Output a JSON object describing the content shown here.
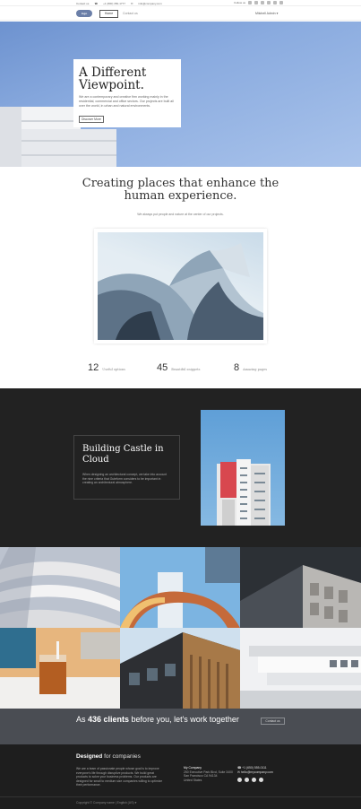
{
  "topbar": {
    "items": [
      "Contact us",
      "+1 (800) 350-1777",
      "info@company.com"
    ],
    "follow_label": "Follow us"
  },
  "nav": {
    "logo": "logo",
    "home": "Home",
    "contact": "Contact us",
    "user": "Mitchell Admin"
  },
  "hero": {
    "title": "A Different Viewpoint.",
    "text": "We are a contemporary and creative firm working mainly in the residential, commercial and office sectors. Our projects are built all over the world, in urban and natural environments.",
    "button": "Discover More"
  },
  "section_places": {
    "title": "Creating places that enhance the human experience.",
    "subtitle": "We always put people and nature at the center of our projects."
  },
  "stats": [
    {
      "value": "12",
      "label": "Useful options"
    },
    {
      "value": "45",
      "label": "Beautiful snippets"
    },
    {
      "value": "8",
      "label": "Amazing pages"
    }
  ],
  "castle": {
    "title": "Building Castle in Cloud",
    "text": "When designing an architectural concept, we take into account the nine criteria that Guteform considers to be important in creating an architectural atmosphere."
  },
  "clients": {
    "prefix": "As ",
    "highlight": "436 clients",
    "suffix": " before you, let's work together",
    "button": "Contact us"
  },
  "footer": {
    "title_bold": "Designed",
    "title_rest": " for companies",
    "about": "We are a team of passionate people whose goal is to improve everyone's life through disruptive products. We build great products to solve your business problems. Our products are designed for small to medium size companies willing to optimize their performance.",
    "company_title": "My Company",
    "company_address": "250 Executive Park Blvd, Suite 3400",
    "company_city": "San Francisco CA 94134",
    "company_country": "United States",
    "phone": "+1 (650) 555-0111",
    "email": "hello@mycompany.com",
    "copyright": "Copyright © Company name",
    "language": "English (US)"
  },
  "colors": {
    "dark_bg": "#222222",
    "banner_bg": "#4a4d53",
    "footer_bg": "#1e1e1e",
    "sky": "#8aabdf"
  }
}
